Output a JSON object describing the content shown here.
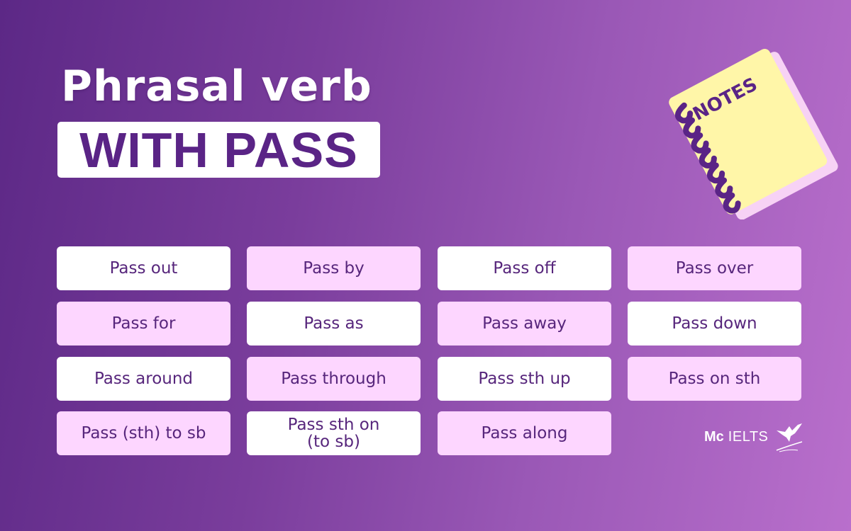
{
  "header": {
    "title_line1": "Phrasal verb",
    "title_line2": "WITH PASS"
  },
  "colors": {
    "background_start": "#5c2886",
    "background_end": "#b96fcc",
    "card_white": "#ffffff",
    "card_pink": "#fdd6ff",
    "text_purple": "#57267c",
    "notebook_cover": "#fff6a8",
    "notebook_pages": "#f7d2f5",
    "spiral": "#5a2486"
  },
  "notebook": {
    "label": "NOTES",
    "icon": "notebook-icon"
  },
  "phrasal_verbs": [
    {
      "label": "Pass out",
      "style": "white"
    },
    {
      "label": "Pass by",
      "style": "pink"
    },
    {
      "label": "Pass off",
      "style": "white"
    },
    {
      "label": "Pass over",
      "style": "pink"
    },
    {
      "label": "Pass for",
      "style": "pink"
    },
    {
      "label": "Pass as",
      "style": "white"
    },
    {
      "label": "Pass away",
      "style": "pink"
    },
    {
      "label": "Pass down",
      "style": "white"
    },
    {
      "label": "Pass around",
      "style": "white"
    },
    {
      "label": "Pass through",
      "style": "pink"
    },
    {
      "label": "Pass sth up",
      "style": "white"
    },
    {
      "label": "Pass on sth",
      "style": "pink"
    },
    {
      "label": "Pass (sth) to sb",
      "style": "pink"
    },
    {
      "label": "Pass sth on (to sb)",
      "style": "white"
    },
    {
      "label": "Pass along",
      "style": "pink"
    }
  ],
  "logo": {
    "brand_bold": "Mc",
    "brand_light": "IELTS",
    "icon": "hummingbird-icon"
  }
}
